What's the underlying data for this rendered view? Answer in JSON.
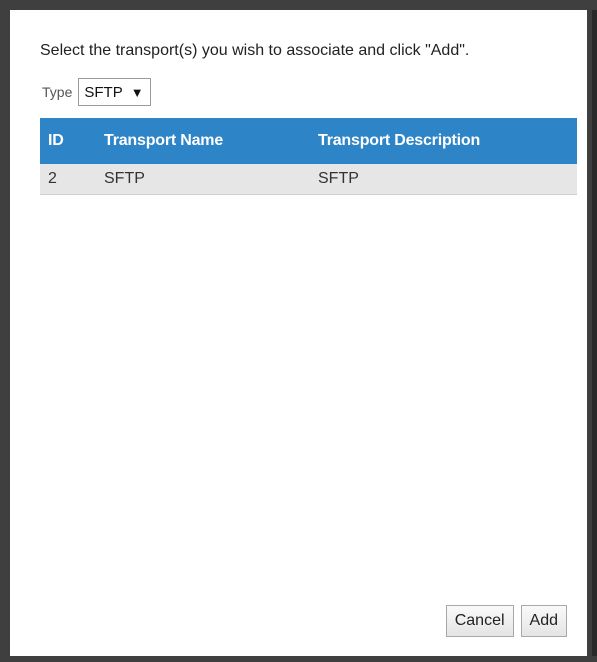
{
  "dialog": {
    "instruction": "Select the transport(s) you wish to associate and click \"Add\"."
  },
  "filter": {
    "type_label": "Type",
    "type_value": "SFTP",
    "chevron": "▼"
  },
  "table": {
    "columns": [
      "ID",
      "Transport Name",
      "Transport Description"
    ],
    "rows": [
      {
        "id": "2",
        "name": "SFTP",
        "description": "SFTP"
      }
    ]
  },
  "actions": {
    "cancel_label": "Cancel",
    "add_label": "Add"
  },
  "colors": {
    "header_bg": "#2d84c6",
    "row_bg": "#e6e6e6",
    "frame": "#3f3f3f"
  }
}
